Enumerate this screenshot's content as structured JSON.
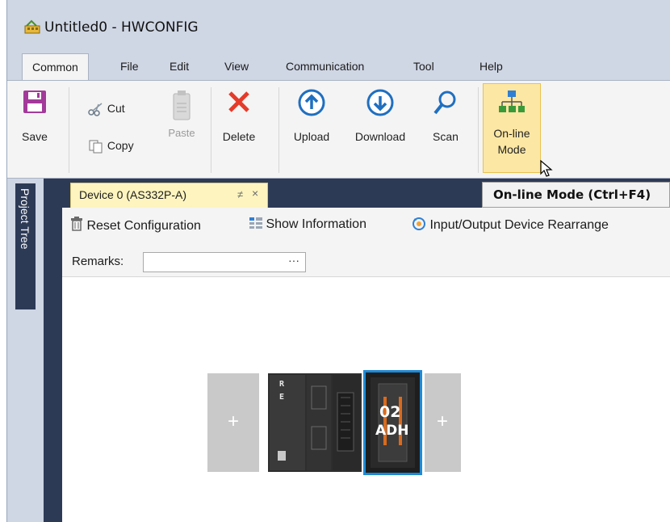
{
  "window": {
    "title": "Untitled0 - HWCONFIG"
  },
  "menu": {
    "tabs": [
      {
        "label": "Common"
      },
      {
        "label": "File"
      },
      {
        "label": "Edit"
      },
      {
        "label": "View"
      },
      {
        "label": "Communication"
      },
      {
        "label": "Tool"
      },
      {
        "label": "Help"
      }
    ]
  },
  "ribbon": {
    "save": "Save",
    "cut": "Cut",
    "copy": "Copy",
    "paste": "Paste",
    "delete": "Delete",
    "upload": "Upload",
    "download": "Download",
    "scan": "Scan",
    "online_line1": "On-line",
    "online_line2": "Mode"
  },
  "tooltip": {
    "text": "On-line Mode (Ctrl+F4)"
  },
  "sidebar": {
    "project_tree": "Project Tree"
  },
  "document": {
    "tab_label": "Device 0 (AS332P-A)",
    "pin_glyph": "≠",
    "close_glyph": "×",
    "toolbar": {
      "reset": "Reset Configuration",
      "show_info": "Show Information",
      "rearrange": "Input/Output Device Rearrange"
    },
    "remarks_label": "Remarks:",
    "remarks_value": "",
    "remarks_more": "···"
  },
  "rack": {
    "plus": "+",
    "cpu_label_1": "R",
    "cpu_label_2": "E",
    "module_num": "02",
    "module_code": "ADH"
  },
  "colors": {
    "accent_blue": "#1f6fc0",
    "selection_border": "#1e8ad6",
    "delete_red": "#e53a2a",
    "save_purple": "#a33a9a",
    "online_highlight": "#fce7a4",
    "sidebar_navy": "#2d3a56",
    "tab_yellow": "#fdf4bf"
  },
  "icons": {
    "app": "hwconfig-app-icon",
    "save": "floppy-disk-icon",
    "cut": "scissors-icon",
    "copy": "copy-icon",
    "paste": "clipboard-icon",
    "delete": "red-x-icon",
    "upload": "circle-up-arrow-icon",
    "download": "circle-down-arrow-icon",
    "scan": "magnifier-icon",
    "online": "network-tree-icon",
    "reset": "trash-icon",
    "show_info": "info-grid-icon",
    "rearrange": "rearrange-gear-icon"
  }
}
